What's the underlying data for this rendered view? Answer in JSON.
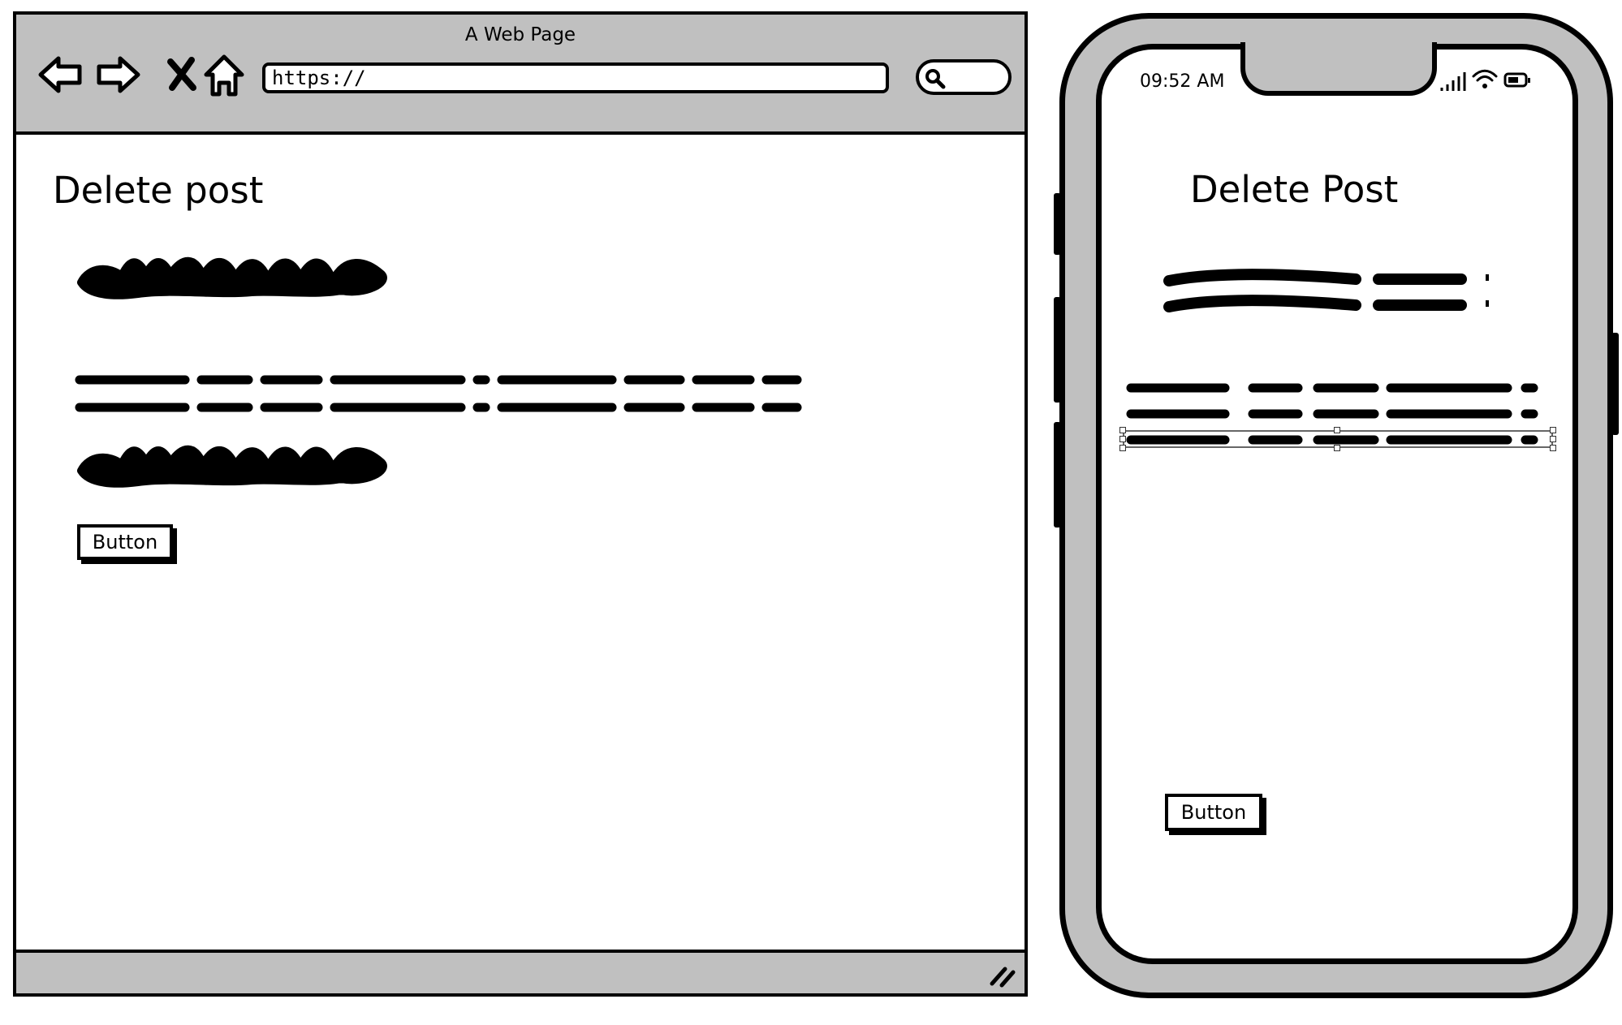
{
  "browser": {
    "title": "A Web Page",
    "url": "https://",
    "page": {
      "heading": "Delete post",
      "button_label": "Button"
    }
  },
  "phone": {
    "status_time": "09:52 AM",
    "page": {
      "heading": "Delete Post",
      "button_label": "Button"
    }
  },
  "icons": {
    "back": "back-arrow-icon",
    "forward": "forward-arrow-icon",
    "stop": "close-icon",
    "home": "home-icon",
    "search": "search-icon",
    "resize": "resize-grip-icon",
    "signal": "signal-icon",
    "wifi": "wifi-icon",
    "battery": "battery-icon"
  },
  "colors": {
    "chrome_fill": "#c0c0c0",
    "stroke": "#000000",
    "page_background": "#ffffff"
  }
}
